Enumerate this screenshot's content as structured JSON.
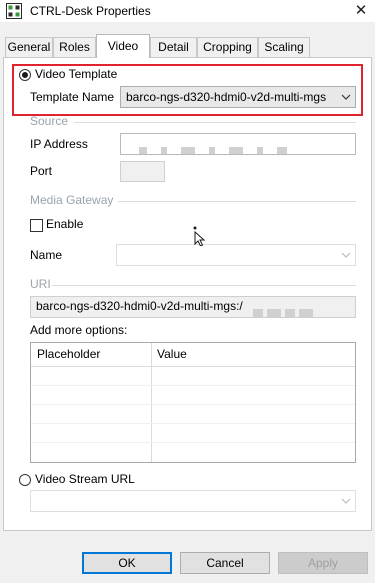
{
  "window": {
    "title": "CTRL-Desk Properties",
    "close_glyph": "✕",
    "icon": "app-grid-icon"
  },
  "tabs": [
    {
      "label": "General",
      "active": false
    },
    {
      "label": "Roles",
      "active": false
    },
    {
      "label": "Video",
      "active": true
    },
    {
      "label": "Detail",
      "active": false
    },
    {
      "label": "Cropping",
      "active": false
    },
    {
      "label": "Scaling",
      "active": false
    }
  ],
  "video": {
    "template_radio_label": "Video Template",
    "template_selected": true,
    "template_name_label": "Template Name",
    "template_name_value": "barco-ngs-d320-hdmi0-v2d-multi-mgs",
    "source_group": "Source",
    "ip_address_label": "IP Address",
    "ip_address_value": "",
    "port_label": "Port",
    "port_value": "",
    "media_gateway_group": "Media Gateway",
    "enable_label": "Enable",
    "enable_checked": false,
    "name_label": "Name",
    "name_value": "",
    "uri_group": "URI",
    "uri_value": "barco-ngs-d320-hdmi0-v2d-multi-mgs:/",
    "more_options_label": "Add more options:",
    "options_table": {
      "columns": [
        "Placeholder",
        "Value"
      ],
      "rows": []
    },
    "stream_url_radio_label": "Video Stream URL",
    "stream_url_selected": false,
    "stream_url_value": ""
  },
  "buttons": {
    "ok": "OK",
    "cancel": "Cancel",
    "apply": "Apply"
  },
  "colors": {
    "highlight": "#e0242e",
    "default_button_border": "#0078d7"
  }
}
